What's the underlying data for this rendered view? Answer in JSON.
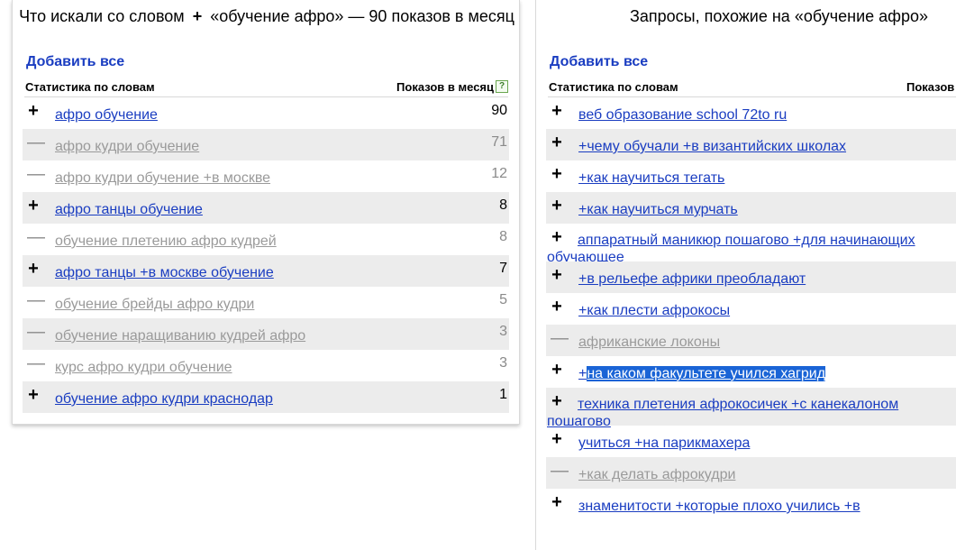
{
  "left": {
    "title_prefix": "Что искали со словом",
    "title_plus": "+",
    "title_suffix": "«обучение афро» — 90 показов в месяц",
    "add_all": "Добавить все",
    "col_words": "Статистика по словам",
    "col_shows": "Показов в месяц",
    "help": "?",
    "rows": [
      {
        "sign": "+",
        "phrase": "афро обучение",
        "count": "90"
      },
      {
        "sign": "—",
        "phrase": "афро кудри обучение",
        "count": "71"
      },
      {
        "sign": "—",
        "phrase": "афро кудри обучение +в москве",
        "count": "12"
      },
      {
        "sign": "+",
        "phrase": "афро танцы обучение",
        "count": "8"
      },
      {
        "sign": "—",
        "phrase": "обучение плетению афро кудрей",
        "count": "8"
      },
      {
        "sign": "+",
        "phrase": "афро танцы +в москве обучение",
        "count": "7"
      },
      {
        "sign": "—",
        "phrase": "обучение брейды афро кудри",
        "count": "5"
      },
      {
        "sign": "—",
        "phrase": "обучение наращиванию кудрей афро",
        "count": "3"
      },
      {
        "sign": "—",
        "phrase": "курс афро кудри обучение",
        "count": "3"
      },
      {
        "sign": "+",
        "phrase": "обучение афро кудри краснодар",
        "count": "1"
      }
    ]
  },
  "right": {
    "title": "Запросы, похожие на «обучение афро»",
    "add_all": "Добавить все",
    "col_words": "Статистика по словам",
    "col_shows": "Показов",
    "rows": [
      {
        "sign": "+",
        "phrase": "веб образование school 72to ru"
      },
      {
        "sign": "+",
        "phrase": "+чему обучали +в византийских школах"
      },
      {
        "sign": "+",
        "phrase": "+как научиться тегать"
      },
      {
        "sign": "+",
        "phrase": "+как научиться мурчать"
      },
      {
        "sign": "+",
        "phrase": "аппаратный маникюр пошагово +для начинающих обучающее"
      },
      {
        "sign": "+",
        "phrase": "+в рельефе африки преобладают"
      },
      {
        "sign": "+",
        "phrase": "+как плести афрокосы"
      },
      {
        "sign": "—",
        "phrase": "африканские локоны"
      },
      {
        "sign": "+",
        "phrase_start": "+",
        "phrase_selected": "на каком факультете учился хагрид"
      },
      {
        "sign": "+",
        "phrase": "техника плетения афрокосичек +с канекалоном пошагово"
      },
      {
        "sign": "+",
        "phrase": "учиться +на парикмахера"
      },
      {
        "sign": "—",
        "phrase": "+как делать афрокудри"
      },
      {
        "sign": "+",
        "phrase": "знаменитости +которые плохо учились +в"
      }
    ]
  }
}
